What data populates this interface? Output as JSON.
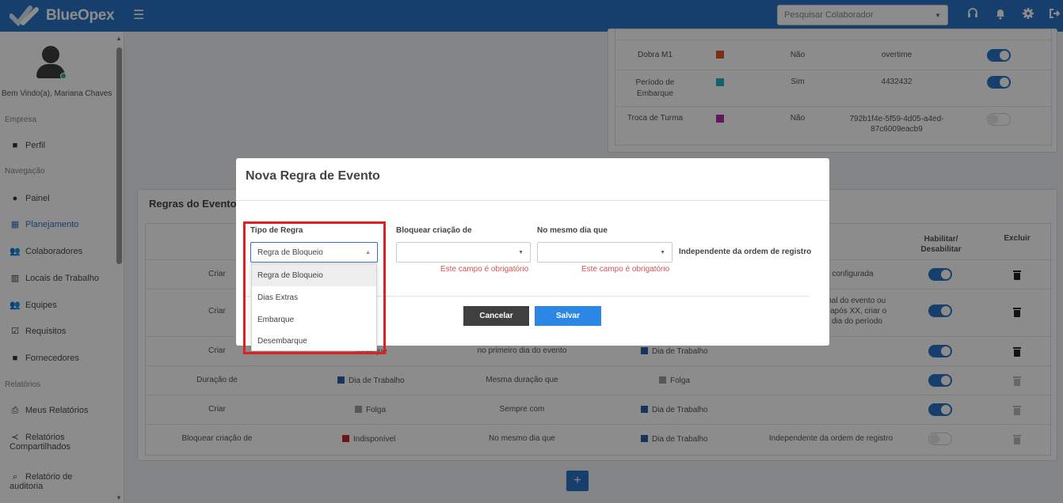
{
  "app": {
    "brand": "BlueOpex"
  },
  "topbar": {
    "search_placeholder": "Pesquisar Colaborador",
    "icons": [
      "headset-icon",
      "bell-icon",
      "gear-icon",
      "logout-icon"
    ]
  },
  "sidebar": {
    "welcome": "Bem Vindo(a), Mariana Chaves",
    "sections": {
      "empresa": "Empresa",
      "navegacao": "Navegação",
      "relatorios": "Relatórios"
    },
    "items": {
      "perfil": "Perfil",
      "painel": "Painel",
      "planejamento": "Planejamento",
      "colaboradores": "Colaboradores",
      "locais": "Locais de Trabalho",
      "equipes": "Equipes",
      "requisitos": "Requisitos",
      "fornecedores": "Fornecedores",
      "meus_relatorios": "Meus Relatórios",
      "relatorios_compartilhados_1": "Relatórios",
      "relatorios_compartilhados_2": "Compartilhados",
      "relatorio_auditoria_1": "Relatório de",
      "relatorio_auditoria_2": "auditoria"
    }
  },
  "events_table": {
    "rows": [
      {
        "name": "Dobra M1",
        "color": "#e0542b",
        "flag": "Não",
        "code": "overtime",
        "enabled": true
      },
      {
        "name_1": "Período de",
        "name_2": "Embarque",
        "color": "#1fb7c8",
        "flag": "Sim",
        "code": "4432432",
        "enabled": true
      },
      {
        "name": "Troca de Turma",
        "color": "#b02aa8",
        "flag": "Não",
        "code_1": "792b1f4e-5f59-4d05-a4ed-",
        "code_2": "87c6009eacb9",
        "enabled": false
      }
    ]
  },
  "rules": {
    "title": "Regras do Evento",
    "headers": {
      "toggle_1": "Habilitar/",
      "toggle_2": "Desabilitar",
      "delete": "Excluir"
    },
    "rows": [
      {
        "action": "Criar",
        "tail": "a configurada",
        "enabled": true,
        "deletable": true
      },
      {
        "action": "Criar",
        "tail_1": "inal do evento ou",
        "tail_2": "r após XX, criar o",
        "tail_3": "dia do período",
        "enabled": true,
        "deletable": true
      },
      {
        "action": "Criar",
        "event_partial": "mbarque",
        "condition": "no primeiro dia do evento",
        "target": "Dia de Trabalho",
        "target_color": "#2a5fb0",
        "enabled": true,
        "deletable": true
      },
      {
        "action": "Duração de",
        "event": "Dia de Trabalho",
        "event_color": "#2a5fb0",
        "condition": "Mesma duração que",
        "target": "Folga",
        "target_color": "#9e9e9e",
        "enabled": true,
        "deletable": false
      },
      {
        "action": "Criar",
        "event": "Folga",
        "event_color": "#9e9e9e",
        "condition": "Sempre com",
        "target": "Dia de Trabalho",
        "target_color": "#2a5fb0",
        "enabled": true,
        "deletable": false
      },
      {
        "action": "Bloquear criação de",
        "event": "Indisponível",
        "event_color": "#c62828",
        "condition": "No mesmo dia que",
        "target": "Dia de Trabalho",
        "target_color": "#2a5fb0",
        "extra": "Independente da ordem de registro",
        "enabled": false,
        "deletable": false
      }
    ],
    "add_label": "+"
  },
  "modal": {
    "title": "Nova Regra de Evento",
    "tipo_label": "Tipo de Regra",
    "tipo_value": "Regra de Bloqueio",
    "bloquear_label": "Bloquear criação de",
    "mesmo_dia_label": "No mesmo dia que",
    "required_error": "Este campo é obrigatório",
    "independent_text": "Independente da ordem de registro",
    "cancel": "Cancelar",
    "save": "Salvar",
    "options": [
      "Regra de Bloqueio",
      "Dias Extras",
      "Embarque",
      "Desembarque"
    ],
    "selected_option": "Regra de Bloqueio"
  }
}
